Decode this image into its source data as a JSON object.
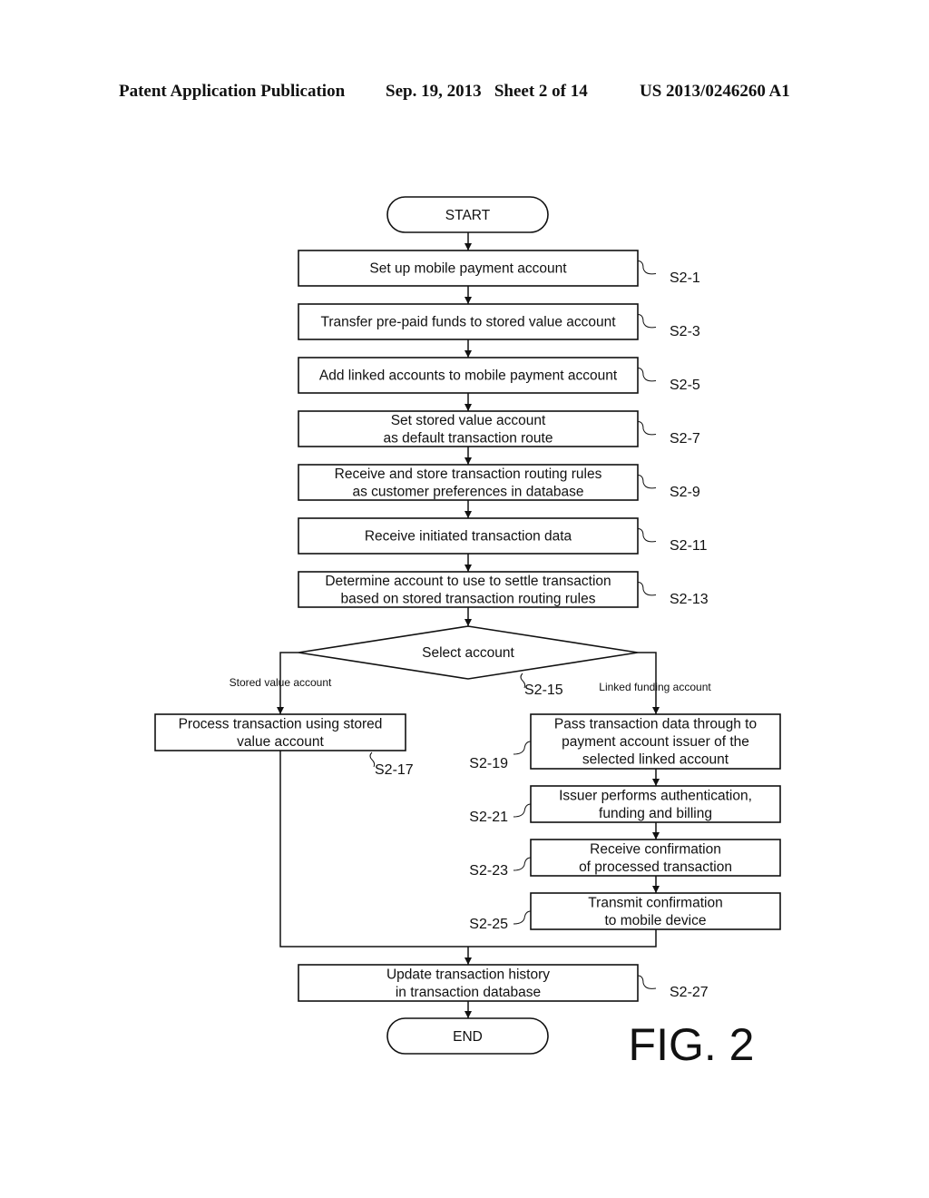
{
  "header": {
    "publication": "Patent Application Publication",
    "date_sheet": "Sep. 19, 2013   Sheet 2 of 14",
    "patent_number": "US 2013/0246260 A1"
  },
  "figure_label": "FIG. 2",
  "flowchart": {
    "start": "START",
    "end": "END",
    "steps": [
      {
        "id": "S2-1",
        "lines": [
          "Set up mobile payment account"
        ]
      },
      {
        "id": "S2-3",
        "lines": [
          "Transfer pre-paid funds to stored value account"
        ]
      },
      {
        "id": "S2-5",
        "lines": [
          "Add linked accounts to mobile payment account"
        ]
      },
      {
        "id": "S2-7",
        "lines": [
          "Set stored value account",
          "as default transaction route"
        ]
      },
      {
        "id": "S2-9",
        "lines": [
          "Receive and store transaction routing rules",
          "as customer preferences in database"
        ]
      },
      {
        "id": "S2-11",
        "lines": [
          "Receive initiated transaction data"
        ]
      },
      {
        "id": "S2-13",
        "lines": [
          "Determine account to use to settle transaction",
          "based on stored transaction routing rules"
        ]
      }
    ],
    "decision": {
      "id": "S2-15",
      "label": "Select account"
    },
    "left_branch": {
      "label": "Stored value account",
      "steps": [
        {
          "id": "S2-17",
          "lines": [
            "Process transaction using stored",
            "value account"
          ]
        }
      ]
    },
    "right_branch": {
      "label": "Linked funding account",
      "steps": [
        {
          "id": "S2-19",
          "lines": [
            "Pass transaction data through to",
            "payment account issuer of the",
            "selected linked account"
          ]
        },
        {
          "id": "S2-21",
          "lines": [
            "Issuer performs authentication,",
            "funding and billing"
          ]
        },
        {
          "id": "S2-23",
          "lines": [
            "Receive confirmation",
            "of processed transaction"
          ]
        },
        {
          "id": "S2-25",
          "lines": [
            "Transmit confirmation",
            "to mobile device"
          ]
        }
      ]
    },
    "final_step": {
      "id": "S2-27",
      "lines": [
        "Update transaction history",
        "in transaction database"
      ]
    }
  }
}
